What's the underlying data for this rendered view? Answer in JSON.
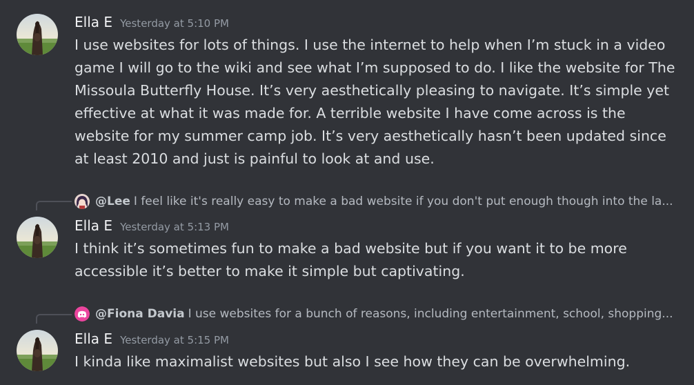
{
  "messages": [
    {
      "author": "Ella E",
      "timestamp": "Yesterday at 5:10 PM",
      "content": "I use websites for lots of things. I use the internet to help when I’m stuck in a video game I will go to the wiki and see what I’m supposed to do. I like the website for The Missoula Butterfly House. It’s very aesthetically pleasing to navigate. It’s simple yet effective at what it was made for. A terrible website I have come across is the website for my summer camp job. It’s very aesthetically hasn’t been updated since at least 2010 and just is painful to look at and use."
    },
    {
      "reply": {
        "mention": "@Lee",
        "preview": "I feel like it's really easy to make a bad website if you don't put enough though into the la...",
        "avatar_icon": "anime-avatar-icon"
      },
      "author": "Ella E",
      "timestamp": "Yesterday at 5:13 PM",
      "content": "I think it’s sometimes fun to make a bad website but if you want it to be more accessible it’s better to make it simple but captivating."
    },
    {
      "reply": {
        "mention": "@Fiona Davia",
        "preview": "I use websites for a bunch of reasons, including entertainment, school, shopping...",
        "avatar_icon": "discord-logo-icon",
        "avatar_color": "#eb459e"
      },
      "author": "Ella E",
      "timestamp": "Yesterday at 5:15 PM",
      "content": "I kinda like maximalist websites but also I see how they can be overwhelming."
    }
  ],
  "theme": {
    "background": "#313338",
    "username_color": "#f2f3f5",
    "text_color": "#dbdee1",
    "timestamp_color": "#949ba4"
  }
}
